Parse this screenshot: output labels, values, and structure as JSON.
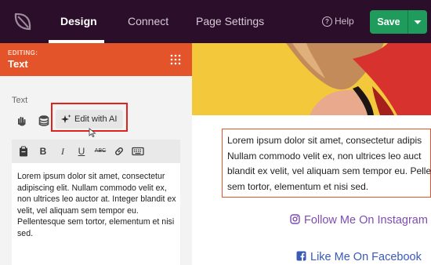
{
  "nav": {
    "tabs": [
      {
        "label": "Design"
      },
      {
        "label": "Connect"
      },
      {
        "label": "Page Settings"
      }
    ],
    "help_label": "Help",
    "save_label": "Save"
  },
  "panel": {
    "editing_label": "EDITING:",
    "title": "Text",
    "section_label": "Text",
    "ai_button_label": "Edit with AI",
    "editor_text": "Lorem ipsum dolor sit amet, consectetur adipiscing elit. Nullam commodo velit ex, non ultrices leo auctor at. Integer blandit ex velit, vel aliquam sem tempor eu. Pellentesque sem tortor, elementum et nisi sed."
  },
  "toolbar": {
    "items": [
      "paste-icon",
      "bold-icon",
      "italic-icon",
      "underline-icon",
      "strikethrough-icon",
      "link-icon",
      "keyboard-icon"
    ],
    "bold": "B",
    "italic": "I",
    "underline": "U",
    "strike": "ABC"
  },
  "preview": {
    "text_lines": [
      "Lorem ipsum dolor sit amet, consectetur adipis",
      "Nullam commodo velit ex, non ultrices leo auct",
      "blandit ex velit, vel aliquam sem tempor eu. Pelle",
      "sem tortor, elementum et nisi sed."
    ],
    "instagram_label": "Follow Me On Instagram",
    "facebook_label": "Like Me On Facebook"
  },
  "colors": {
    "nav_bg": "#2b0f2a",
    "accent_orange": "#e4542a",
    "save_green": "#1f9c5b",
    "highlight_red": "#e0221e",
    "instagram_purple": "#7d4cb3",
    "facebook_blue": "#3b59b6",
    "hero_yellow": "#f3c83b"
  }
}
